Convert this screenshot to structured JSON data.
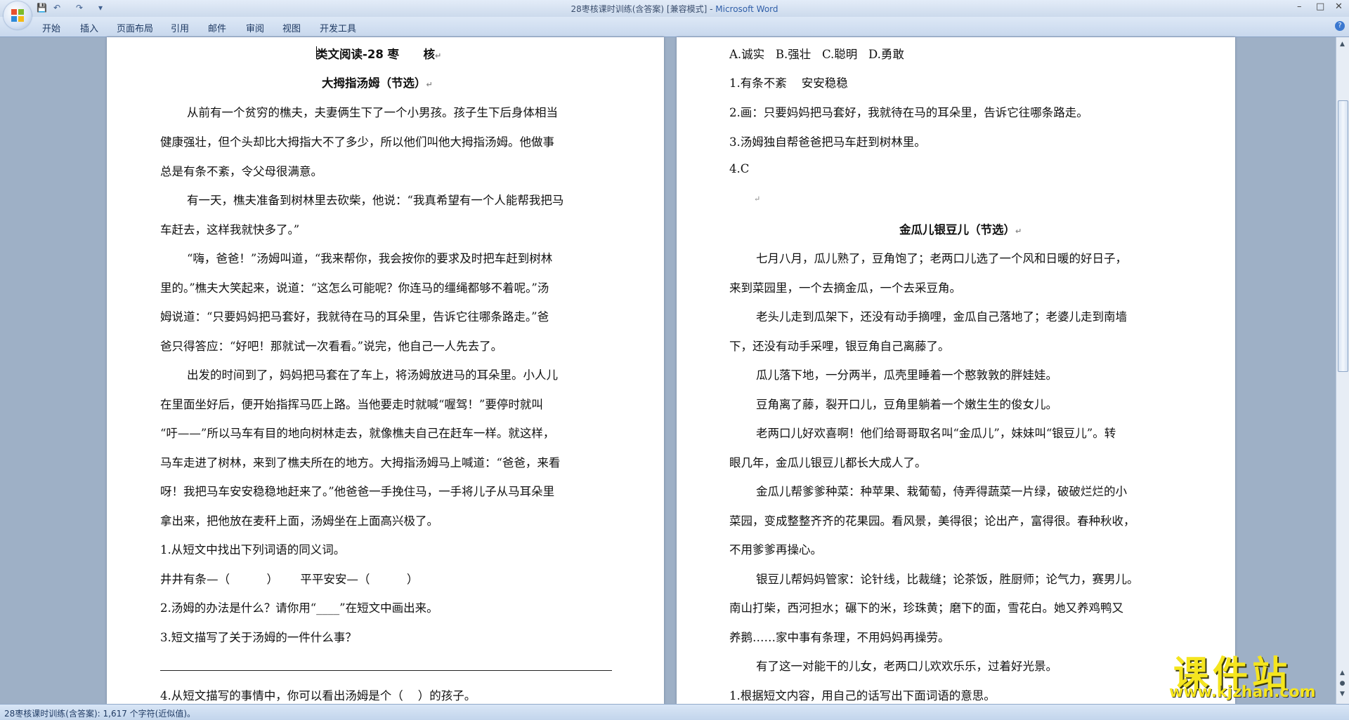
{
  "window": {
    "title_doc": "28枣核课时训练(含答案) [兼容模式] - ",
    "title_app": "Microsoft Word",
    "minimize": "–",
    "maximize": "□",
    "close": "✕"
  },
  "qat": {
    "save": "💾",
    "undo": "↶",
    "redo": "↷",
    "more": "▾"
  },
  "ribbon_tabs": [
    "开始",
    "插入",
    "页面布局",
    "引用",
    "邮件",
    "审阅",
    "视图",
    "开发工具"
  ],
  "help": "?",
  "page_left": {
    "title": "类文阅读-28 枣      核",
    "subtitle": "大拇指汤姆（节选）",
    "lines": [
      "从前有一个贫穷的樵夫，夫妻俩生下了一个小男孩。孩子生下后身体相当",
      "健康强壮，但个头却比大拇指大不了多少，所以他们叫他大拇指汤姆。他做事",
      "总是有条不紊，令父母很满意。",
      "有一天，樵夫准备到树林里去砍柴，他说：“我真希望有一个人能帮我把马",
      "车赶去，这样我就快多了。”",
      "“嗨，爸爸！”汤姆叫道，“我来帮你，我会按你的要求及时把车赶到树林",
      "里的。”樵夫大笑起来，说道：“这怎么可能呢？你连马的缰绳都够不着呢。”汤",
      "姆说道：“只要妈妈把马套好，我就待在马的耳朵里，告诉它往哪条路走。”爸",
      "爸只得答应：“好吧！那就试一次看看。”说完，他自己一人先去了。",
      "出发的时间到了，妈妈把马套在了车上，将汤姆放进马的耳朵里。小人儿",
      "在里面坐好后，便开始指挥马匹上路。当他要走时就喊“喔驾！”要停时就叫",
      "“吁——”所以马车有目的地向树林走去，就像樵夫自己在赶车一样。就这样，",
      "马车走进了树林，来到了樵夫所在的地方。大拇指汤姆马上喊道：“爸爸，来看",
      "呀！我把马车安安稳稳地赶来了。”他爸爸一手挽住马，一手将儿子从马耳朵里",
      "拿出来，把他放在麦秆上面，汤姆坐在上面高兴极了。",
      "1.从短文中找出下列词语的同义词。",
      "井井有条—（          ）      平平安安—（          ）",
      "2.汤姆的办法是什么？请你用“____”在短文中画出来。",
      "3.短文描写了关于汤姆的一件什么事？",
      "4.从短文描写的事情中，你可以看出汤姆是个（    ）的孩子。"
    ]
  },
  "page_right": {
    "answers": [
      "A.诚实   B.强壮   C.聪明   D.勇敢",
      "1.有条不紊    安安稳稳",
      "2.画：只要妈妈把马套好，我就待在马的耳朵里，告诉它往哪条路走。",
      "3.汤姆独自帮爸爸把马车赶到树林里。",
      "4.C"
    ],
    "subtitle": "金瓜儿银豆儿（节选）",
    "lines": [
      "七月八月，瓜儿熟了，豆角饱了；老两口儿选了一个风和日暖的好日子，",
      "来到菜园里，一个去摘金瓜，一个去采豆角。",
      "老头儿走到瓜架下，还没有动手摘哩，金瓜自己落地了；老婆儿走到南墙",
      "下，还没有动手采哩，银豆角自己离藤了。",
      "瓜儿落下地，一分两半，瓜壳里睡着一个憨敦敦的胖娃娃。",
      "豆角离了藤，裂开口儿，豆角里躺着一个嫩生生的俊女儿。",
      "老两口儿好欢喜啊！他们给哥哥取名叫“金瓜儿”，妹妹叫“银豆儿”。转",
      "眼几年，金瓜儿银豆儿都长大成人了。",
      "金瓜儿帮爹爹种菜：种苹果、栽葡萄，侍弄得蔬菜一片绿，破破烂烂的小",
      "菜园，变成整整齐齐的花果园。看风景，美得很；论出产，富得很。春种秋收，",
      "不用爹爹再操心。",
      "银豆儿帮妈妈管家：论针线，比裁缝；论茶饭，胜厨师；论气力，赛男儿。",
      "南山打柴，西河担水；碾下的米，珍珠黄；磨下的面，雪花白。她又养鸡鸭又",
      "养鹅……家中事有条理，不用妈妈再操劳。",
      "有了这一对能干的儿女，老两口儿欢欢乐乐，过着好光景。",
      "1.根据短文内容，用自己的话写出下面词语的意思。"
    ]
  },
  "para_mark": "↵",
  "status": {
    "text": "28枣核课时训练(含答案): 1,617 个字符(近似值)。"
  },
  "watermark": {
    "main": "课件站",
    "url": "www.kjzhan.com"
  }
}
